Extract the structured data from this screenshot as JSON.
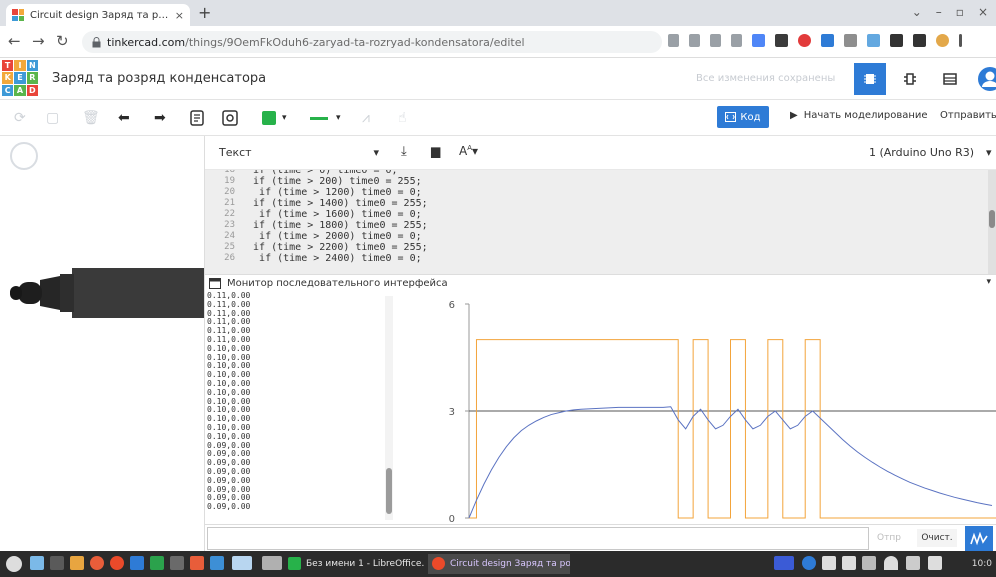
{
  "browser": {
    "tab_title": "Circuit design Заряд та розр…",
    "tab_close": "×",
    "new_tab": "+",
    "url_host": "tinkercad.com",
    "url_path": "/things/9OemFkOduh6-zaryad-ta-rozryad-kondensatora/editel",
    "window_controls": [
      "⌄",
      "–",
      "▫",
      "×"
    ]
  },
  "app": {
    "logo_letters": [
      "T",
      "I",
      "N",
      "K",
      "E",
      "R",
      "C",
      "A",
      "D"
    ],
    "project_title": "Заряд та розряд конденсатора",
    "save_status": "Все изменения сохранены"
  },
  "toolbar": {
    "code_label": "Код",
    "simulate_label": "Начать моделирование",
    "send_label": "Отправить"
  },
  "code_editor": {
    "mode": "Текст",
    "board": "1 (Arduino Uno R3)",
    "lines": [
      {
        "n": "18",
        "text": "  if (time > 0) time0 = 0;"
      },
      {
        "n": "19",
        "text": "  if (time > 200) time0 = 255;"
      },
      {
        "n": "20",
        "text": "   if (time > 1200) time0 = 0;"
      },
      {
        "n": "21",
        "text": "  if (time > 1400) time0 = 255;"
      },
      {
        "n": "22",
        "text": "   if (time > 1600) time0 = 0;"
      },
      {
        "n": "23",
        "text": "  if (time > 1800) time0 = 255;"
      },
      {
        "n": "24",
        "text": "   if (time > 2000) time0 = 0;"
      },
      {
        "n": "25",
        "text": "  if (time > 2200) time0 = 255;"
      },
      {
        "n": "26",
        "text": "   if (time > 2400) time0 = 0;"
      }
    ]
  },
  "serial_monitor": {
    "title": "Монитор последовательного интерфейса",
    "log": [
      "0.11,0.00",
      "0.11,0.00",
      "0.11,0.00",
      "0.11,0.00",
      "0.11,0.00",
      "0.11,0.00",
      "0.10,0.00",
      "0.10,0.00",
      "0.10,0.00",
      "0.10,0.00",
      "0.10,0.00",
      "0.10,0.00",
      "0.10,0.00",
      "0.10,0.00",
      "0.10,0.00",
      "0.10,0.00",
      "0.10,0.00",
      "0.09,0.00",
      "0.09,0.00",
      "0.09,0.00",
      "0.09,0.00",
      "0.09,0.00",
      "0.09,0.00",
      "0.09,0.00",
      "0.09,0.00"
    ],
    "send_label": "Отпр",
    "clear_label": "Очист."
  },
  "chart_data": {
    "type": "line",
    "ylim": [
      0,
      6
    ],
    "yticks": [
      "6",
      "3",
      "0"
    ],
    "reference_line": 3,
    "x": [
      0,
      2,
      4,
      6,
      8,
      10,
      12,
      14,
      16,
      18,
      20,
      22,
      24,
      26,
      28,
      30,
      32,
      34,
      36,
      38,
      40,
      42,
      44,
      46,
      48,
      50,
      52,
      54,
      56,
      58,
      60,
      62,
      64,
      66,
      68,
      70,
      72,
      74,
      76,
      78,
      80,
      82,
      84,
      86,
      88,
      90,
      92,
      94,
      96,
      98,
      100,
      102,
      104,
      106,
      108,
      110,
      112,
      114,
      116,
      118,
      120,
      122,
      124,
      126,
      128,
      130,
      132,
      134,
      136,
      138,
      140
    ],
    "series": [
      {
        "color": "#f3a43b",
        "values": [
          0,
          5,
          5,
          5,
          5,
          5,
          5,
          5,
          5,
          5,
          5,
          5,
          5,
          5,
          5,
          5,
          5,
          5,
          5,
          5,
          5,
          5,
          5,
          5,
          5,
          5,
          5,
          5,
          0,
          0,
          5,
          5,
          0,
          0,
          0,
          5,
          5,
          0,
          0,
          0,
          5,
          5,
          0,
          0,
          0,
          5,
          5,
          0,
          0,
          0,
          0,
          0,
          0,
          0,
          0,
          0,
          0,
          0,
          0,
          0,
          0,
          0,
          0,
          0,
          0,
          0,
          0,
          0,
          0,
          0,
          0
        ]
      },
      {
        "color": "#5b73c2",
        "values": [
          0,
          0.5,
          0.95,
          1.35,
          1.7,
          2.0,
          2.25,
          2.45,
          2.6,
          2.72,
          2.82,
          2.9,
          2.95,
          3.0,
          3.03,
          3.05,
          3.06,
          3.07,
          3.08,
          3.09,
          3.1,
          3.1,
          3.1,
          3.1,
          3.1,
          3.1,
          3.1,
          3.12,
          2.75,
          2.5,
          2.85,
          3.05,
          2.75,
          2.5,
          2.6,
          2.85,
          3.05,
          2.75,
          2.5,
          2.6,
          2.85,
          3.0,
          2.75,
          2.5,
          2.6,
          2.85,
          3.0,
          2.8,
          2.6,
          2.4,
          2.2,
          2.02,
          1.85,
          1.7,
          1.56,
          1.43,
          1.31,
          1.2,
          1.1,
          1.0,
          0.92,
          0.84,
          0.77,
          0.7,
          0.64,
          0.58,
          0.53,
          0.48,
          0.43,
          0.39,
          0.35
        ]
      }
    ]
  },
  "taskbar": {
    "windows": [
      "Без имени 1 - LibreOffice…",
      "Circuit design Заряд та роз…"
    ],
    "clock": "10:0"
  },
  "colors": {
    "accent": "#2e7bd6",
    "pulse": "#f3a43b",
    "voltage": "#5b73c2"
  }
}
